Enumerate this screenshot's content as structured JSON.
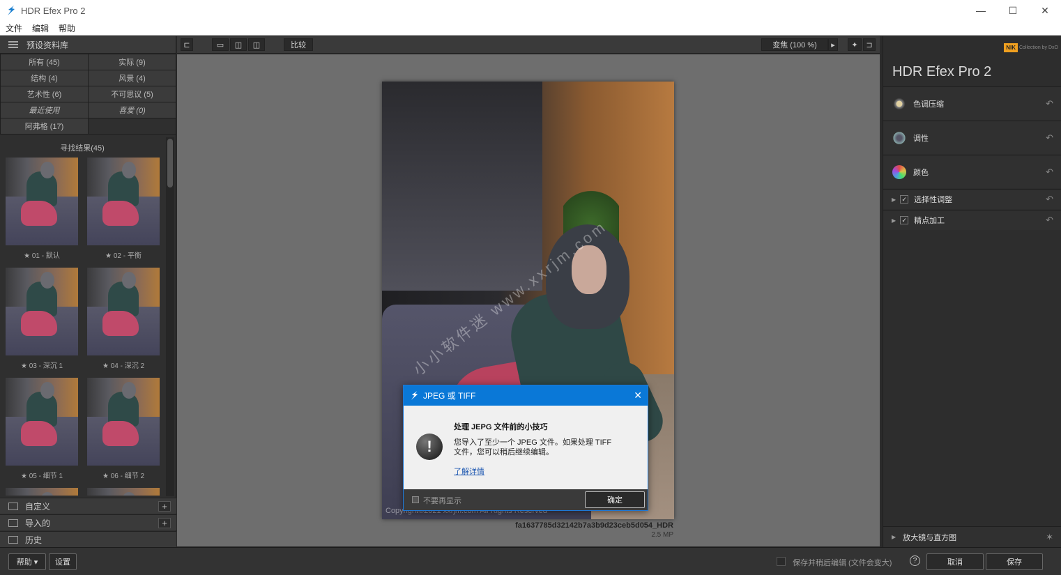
{
  "window": {
    "title": "HDR Efex Pro 2",
    "controls": [
      "—",
      "☐",
      "✕"
    ]
  },
  "menu": [
    "文件",
    "编辑",
    "帮助"
  ],
  "left_panel": {
    "header": "预设资料库",
    "categories": [
      {
        "label": "所有 (45)"
      },
      {
        "label": "实际 (9)"
      },
      {
        "label": "结构 (4)"
      },
      {
        "label": "风景 (4)"
      },
      {
        "label": "艺术性 (6)"
      },
      {
        "label": "不可思议 (5)"
      },
      {
        "label": "最近使用"
      },
      {
        "label": "喜爱 (0)"
      },
      {
        "label": "阿弗格 (17)"
      }
    ],
    "results_title": "寻找结果(45)",
    "presets": [
      {
        "label": "★ 01 - 默认"
      },
      {
        "label": "★ 02 - 平衡"
      },
      {
        "label": "★ 03 - 深沉 1"
      },
      {
        "label": "★ 04 - 深沉 2"
      },
      {
        "label": "★ 05 - 细节 1"
      },
      {
        "label": "★ 06 - 细节 2"
      }
    ],
    "sections": [
      {
        "label": "自定义"
      },
      {
        "label": "导入的"
      },
      {
        "label": "历史"
      }
    ]
  },
  "toolbar": {
    "compare": "比较",
    "zoom": "变焦 (100 %)"
  },
  "image": {
    "watermark": "小小软件迷 www.xxrjm.com",
    "copyright": "Copyright©2021 xxrjm.com All Rights Reserved",
    "filename": "fa1637785d32142b7a3b9d23ceb5d054_HDR",
    "size": "2.5 MP"
  },
  "right_panel": {
    "brand": "Collection by DxO",
    "brand_mark": "NIK",
    "title": "HDR Efex Pro 2",
    "controls": [
      {
        "label": "色调压缩"
      },
      {
        "label": "调性"
      },
      {
        "label": "颜色"
      },
      {
        "label": "选择性调整"
      },
      {
        "label": "精点加工"
      }
    ],
    "bottom": "放大镜与直方图"
  },
  "bottom_bar": {
    "help": "帮助 ▾",
    "settings": "设置",
    "save_later": "保存并稍后编辑 (文件会变大)",
    "cancel": "取消",
    "save": "保存"
  },
  "dialog": {
    "title": "JPEG 或 TIFF",
    "heading": "处理 JEPG 文件前的小技巧",
    "message": "您导入了至少一个 JPEG 文件。如果处理 TIFF 文件，您可以稍后继续编辑。",
    "link": "了解详情",
    "dont_show": "不要再显示",
    "ok": "确定"
  },
  "colors": {
    "accent": "#0a78d7",
    "nik_orange": "#f0a020"
  }
}
